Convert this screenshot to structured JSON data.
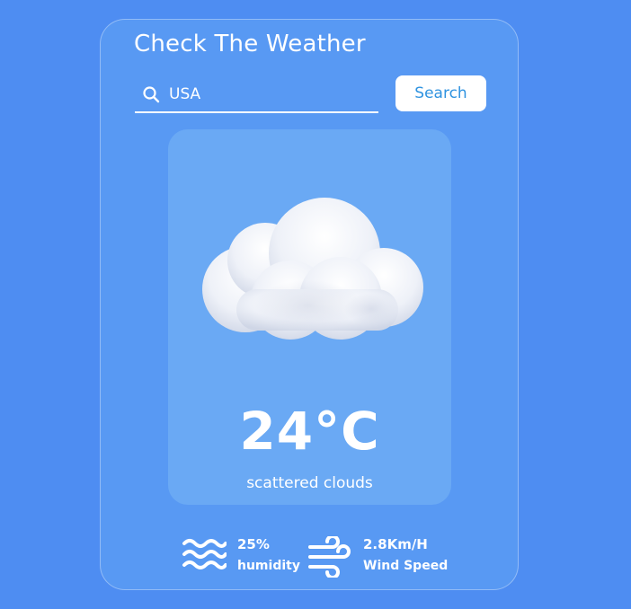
{
  "header": {
    "title": "Check The Weather"
  },
  "search": {
    "value": "USA",
    "button_label": "Search",
    "icon": "search-icon"
  },
  "weather": {
    "icon": "cloud-icon",
    "temperature": "24°C",
    "description": "scattered clouds"
  },
  "details": {
    "humidity": {
      "icon": "waves-icon",
      "value": "25%",
      "label": "humidity"
    },
    "wind": {
      "icon": "wind-icon",
      "value": "2.8Km/H",
      "label": "Wind Speed"
    }
  },
  "colors": {
    "background": "#4e8df2",
    "card": "#5899f3",
    "weather_box": "#6aa9f4",
    "button_text": "#2f93e0"
  }
}
